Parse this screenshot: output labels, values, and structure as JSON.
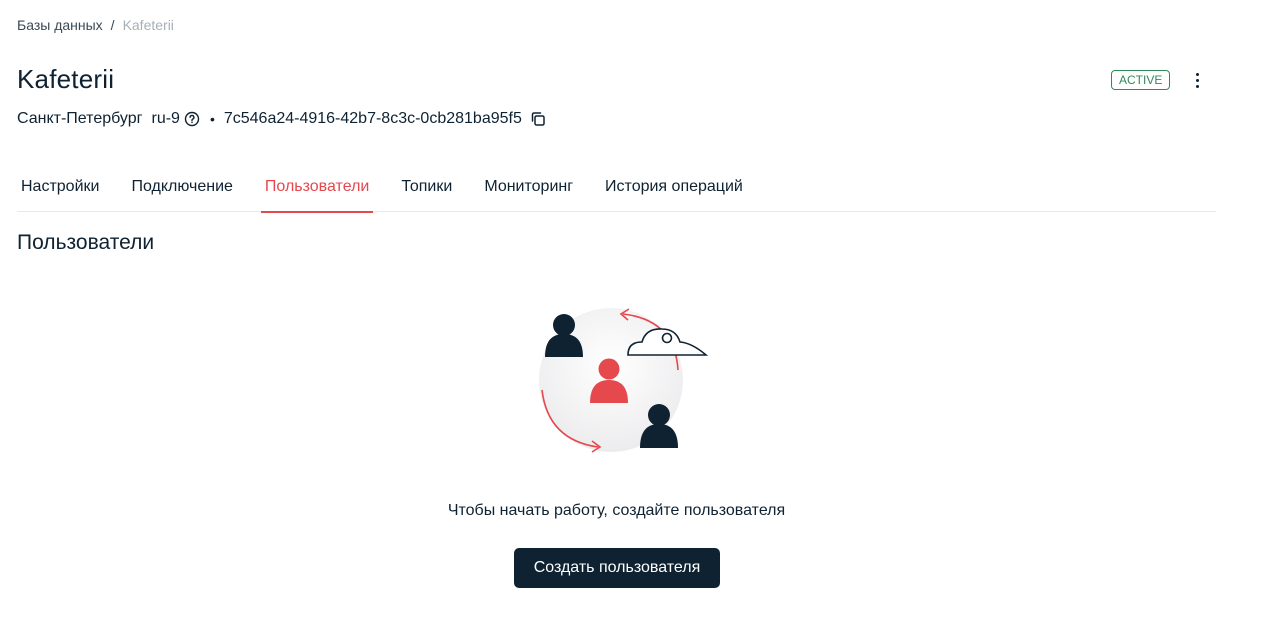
{
  "breadcrumb": {
    "items": [
      {
        "label": "Базы данных"
      },
      {
        "label": "Kafeterii"
      }
    ],
    "separator": "/"
  },
  "header": {
    "title": "Kafeterii",
    "status": "ACTIVE",
    "status_color": "#2f8a5b",
    "more_icon": "more-vertical-icon"
  },
  "details": {
    "city": "Санкт-Петербург",
    "region": "ru-9",
    "help_icon": "help-circle-icon",
    "bullet": "•",
    "id": "7c546a24-4916-42b7-8c3c-0cb281ba95f5",
    "copy_icon": "copy-icon"
  },
  "tabs": [
    {
      "label": "Настройки",
      "active": false
    },
    {
      "label": "Подключение",
      "active": false
    },
    {
      "label": "Пользователи",
      "active": true
    },
    {
      "label": "Топики",
      "active": false
    },
    {
      "label": "Мониторинг",
      "active": false
    },
    {
      "label": "История операций",
      "active": false
    }
  ],
  "section": {
    "title": "Пользователи"
  },
  "empty_state": {
    "illustration": "users-cloud-illustration",
    "message": "Чтобы начать работу, создайте пользователя",
    "button_label": "Создать пользователя"
  },
  "colors": {
    "accent": "#e5484d",
    "primary_dark": "#0f2231"
  }
}
